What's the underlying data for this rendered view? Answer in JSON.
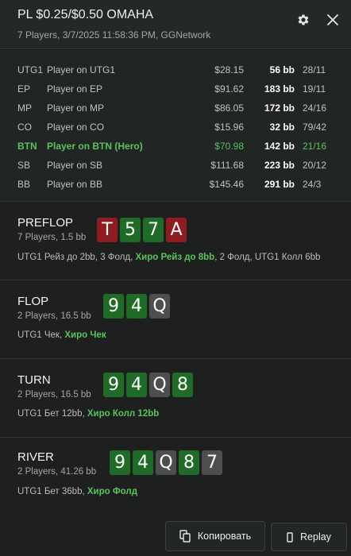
{
  "header": {
    "title": "PL $0.25/$0.50 OMAHA",
    "subtitle": "7 Players, 3/7/2025 11:58:36 PM, GGNetwork",
    "settings_icon": "gear-icon",
    "close_icon": "close-icon"
  },
  "players": [
    {
      "pos": "UTG1",
      "name": "Player on UTG1",
      "stack": "$28.15",
      "bb": "56 bb",
      "stat": "28/11"
    },
    {
      "pos": "EP",
      "name": "Player on EP",
      "stack": "$91.62",
      "bb": "183 bb",
      "stat": "19/11"
    },
    {
      "pos": "MP",
      "name": "Player on MP",
      "stack": "$86.05",
      "bb": "172 bb",
      "stat": "24/16"
    },
    {
      "pos": "CO",
      "name": "Player on CO",
      "stack": "$15.96",
      "bb": "32 bb",
      "stat": "79/42"
    },
    {
      "pos": "BTN",
      "name": "Player on BTN (Hero)",
      "stack": "$70.98",
      "bb": "142 bb",
      "stat": "21/16"
    },
    {
      "pos": "SB",
      "name": "Player on SB",
      "stack": "$111.68",
      "bb": "223 bb",
      "stat": "20/12"
    },
    {
      "pos": "BB",
      "name": "Player on BB",
      "stack": "$145.46",
      "bb": "291 bb",
      "stat": "24/3"
    }
  ],
  "streets": [
    {
      "name": "PREFLOP",
      "info": "7 Players, 1.5 bb",
      "cards": [
        "T",
        "5",
        "7",
        "A"
      ],
      "card_colors": [
        "#8e1c22",
        "#1f6b27",
        "#1f6b27",
        "#8e1c22"
      ],
      "action_before": "UTG1 Рейз до 2bb, 3 Фолд, ",
      "action_hero": "Хиро Рейз до 8bb",
      "action_after": ", 2 Фолд, UTG1 Колл 6bb"
    },
    {
      "name": "FLOP",
      "info": "2 Players, 16.5 bb",
      "cards": [
        "9",
        "4",
        "Q"
      ],
      "card_colors": [
        "#1f6b27",
        "#1f6b27",
        "#4c4f4e"
      ],
      "action_before": "UTG1 Чек, ",
      "action_hero": "Хиро Чек",
      "action_after": ""
    },
    {
      "name": "TURN",
      "info": "2 Players, 16.5 bb",
      "cards": [
        "9",
        "4",
        "Q",
        "8"
      ],
      "card_colors": [
        "#1f6b27",
        "#1f6b27",
        "#4c4f4e",
        "#1f6b27"
      ],
      "action_before": "UTG1 Бет 12bb, ",
      "action_hero": "Хиро Колл 12bb",
      "action_after": ""
    },
    {
      "name": "RIVER",
      "info": "2 Players, 41.26 bb",
      "cards": [
        "9",
        "4",
        "Q",
        "8",
        "7"
      ],
      "card_colors": [
        "#1f6b27",
        "#1f6b27",
        "#4c4f4e",
        "#1f6b27",
        "#4c4f4e"
      ],
      "action_before": "UTG1 Бет 36bb, ",
      "action_hero": "Хиро Фолд",
      "action_after": ""
    }
  ],
  "footer": {
    "copy_label": "Копировать",
    "copy_icon": "copy-icon",
    "replay_label": "Replay",
    "replay_icon": "replay-icon"
  },
  "colors": {
    "background": "#1d201f",
    "hero_green": "#5cc25e",
    "card_red": "#8e1c22",
    "card_green": "#1f6b27",
    "card_gray": "#4c4f4e"
  }
}
